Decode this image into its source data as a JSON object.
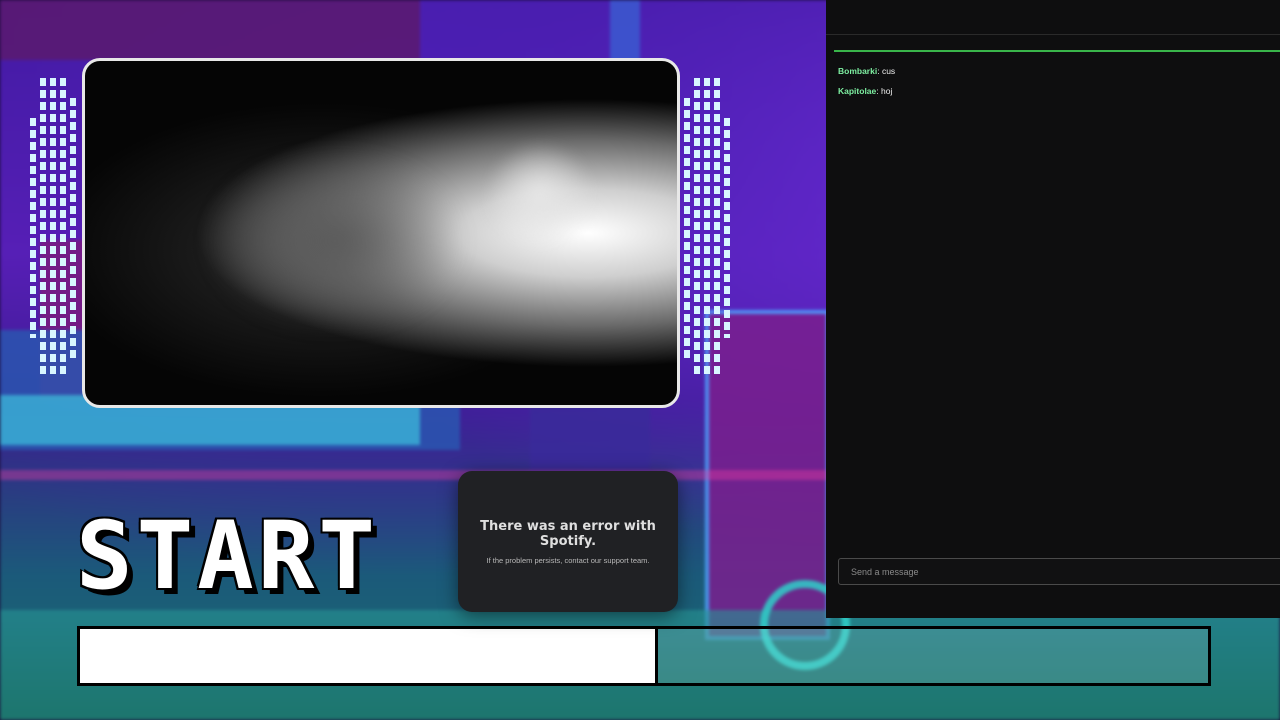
{
  "overlay": {
    "start_label": "START",
    "progress_fraction": 0.51
  },
  "spotify": {
    "title": "There was an error with Spotify.",
    "message": "If the problem persists, contact our support team."
  },
  "chat": {
    "messages": [
      {
        "user": "Bombarki",
        "text": "cus"
      },
      {
        "user": "Kapitolae",
        "text": "hoj"
      }
    ],
    "input_placeholder": "Send a message",
    "accent_color": "#39b54a",
    "username_color": "#7ef0a2"
  }
}
